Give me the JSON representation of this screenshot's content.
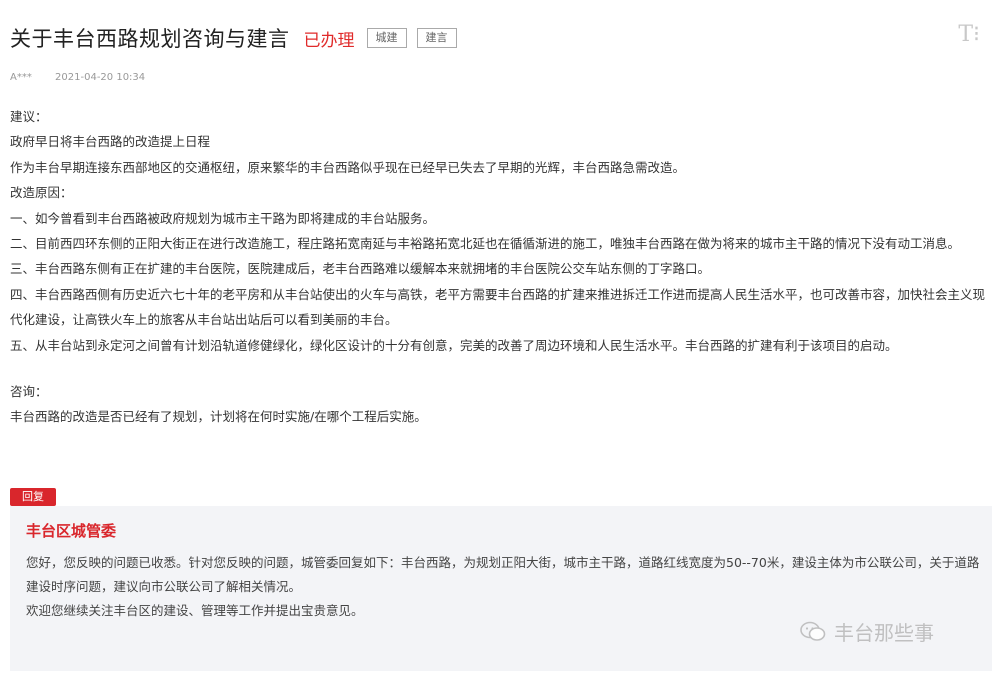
{
  "header": {
    "title": "关于丰台西路规划咨询与建言",
    "status": "已办理",
    "tags": [
      "城建",
      "建言"
    ],
    "font_toggle": "T⁝"
  },
  "meta": {
    "author": "A***",
    "datetime": "2021-04-20 10:34"
  },
  "content": {
    "lines": [
      "建议：",
      "政府早日将丰台西路的改造提上日程",
      "作为丰台早期连接东西部地区的交通枢纽，原来繁华的丰台西路似乎现在已经早已失去了早期的光辉，丰台西路急需改造。",
      "改造原因：",
      "一、如今曾看到丰台西路被政府规划为城市主干路为即将建成的丰台站服务。",
      "二、目前西四环东侧的正阳大街正在进行改造施工，程庄路拓宽南延与丰裕路拓宽北延也在循循渐进的施工，唯独丰台西路在做为将来的城市主干路的情况下没有动工消息。",
      "三、丰台西路东侧有正在扩建的丰台医院，医院建成后，老丰台西路难以缓解本来就拥堵的丰台医院公交车站东侧的丁字路口。",
      "四、丰台西路西侧有历史近六七十年的老平房和从丰台站使出的火车与高铁，老平方需要丰台西路的扩建来推进拆迁工作进而提高人民生活水平，也可改善市容，加快社会主义现代化建设，让高铁火车上的旅客从丰台站出站后可以看到美丽的丰台。",
      "五、从丰台站到永定河之间曾有计划沿轨道修健绿化，绿化区设计的十分有创意，完美的改善了周边环境和人民生活水平。丰台西路的扩建有利于该项目的启动。"
    ],
    "inquiry_label": "咨询：",
    "inquiry_text": "丰台西路的改造是否已经有了规划，计划将在何时实施/在哪个工程后实施。"
  },
  "reply": {
    "badge": "回复",
    "org": "丰台区城管委",
    "lines": [
      "您好，您反映的问题已收悉。针对您反映的问题，城管委回复如下：丰台西路，为规划正阳大街，城市主干路，道路红线宽度为50--70米，建设主体为市公联公司，关于道路建设时序问题，建议向市公联公司了解相关情况。",
      "欢迎您继续关注丰台区的建设、管理等工作并提出宝贵意见。"
    ]
  },
  "watermark": "丰台那些事",
  "colors": {
    "accent": "#d9262c",
    "reply_bg": "#f3f4f7"
  }
}
